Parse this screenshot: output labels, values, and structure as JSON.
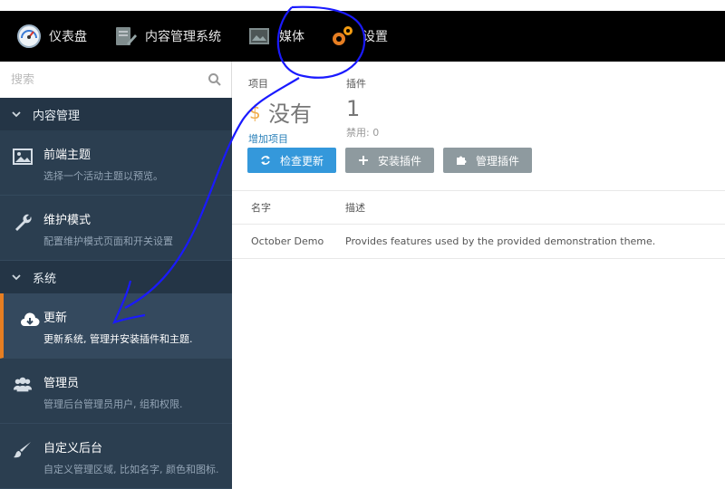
{
  "navbar": {
    "items": [
      {
        "label": "仪表盘",
        "icon": "dashboard-gauge-icon"
      },
      {
        "label": "内容管理系统",
        "icon": "cms-pencil-icon"
      },
      {
        "label": "媒体",
        "icon": "media-image-icon"
      },
      {
        "label": "设置",
        "icon": "settings-gears-icon"
      }
    ]
  },
  "sidebar": {
    "search_placeholder": "搜索",
    "sections": [
      {
        "title": "内容管理",
        "items": [
          {
            "title": "前端主题",
            "desc": "选择一个活动主题以预览。",
            "icon": "picture-icon"
          },
          {
            "title": "维护模式",
            "desc": "配置维护模式页面和开关设置",
            "icon": "wrench-icon"
          }
        ]
      },
      {
        "title": "系统",
        "items": [
          {
            "title": "更新",
            "desc": "更新系统, 管理并安装插件和主题.",
            "icon": "cloud-download-icon"
          },
          {
            "title": "管理员",
            "desc": "管理后台管理员用户, 组和权限.",
            "icon": "users-icon"
          },
          {
            "title": "自定义后台",
            "desc": "自定义管理区域, 比如名字, 颜色和图标.",
            "icon": "paintbrush-icon"
          }
        ]
      }
    ]
  },
  "scoreboard": {
    "projects_label": "项目",
    "projects_value": "没有",
    "projects_link": "增加项目",
    "plugins_label": "插件",
    "plugins_value": "1",
    "plugins_sub": "禁用: 0"
  },
  "toolbar": {
    "check_updates": "检查更新",
    "install_plugins": "安装插件",
    "manage_plugins": "管理插件"
  },
  "table": {
    "headers": [
      "名字",
      "描述"
    ],
    "rows": [
      {
        "name": "October Demo",
        "desc": "Provides features used by the provided demonstration theme."
      }
    ]
  },
  "colors": {
    "navbar_bg": "#000000",
    "sidebar_bg": "#2b3e50",
    "accent_orange": "#e67e22",
    "primary_blue": "#3498db",
    "annotation_blue": "#1a1aff"
  }
}
